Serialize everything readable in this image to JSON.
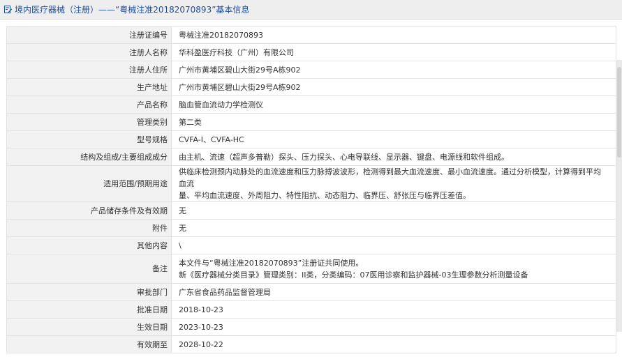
{
  "header": {
    "title": "境内医疗器械（注册）——“粤械注准20182070893”基本信息",
    "icon": "document-edit-icon",
    "color": "#1f4e9a"
  },
  "rows": [
    {
      "label": "注册证编号",
      "value": "粤械注准20182070893"
    },
    {
      "label": "注册人名称",
      "value": "华科盈医疗科技（广州）有限公司"
    },
    {
      "label": "注册人住所",
      "value": "广州市黄埔区碧山大街29号A栋902"
    },
    {
      "label": "生产地址",
      "value": "广州市黄埔区碧山大街29号A栋902"
    },
    {
      "label": "产品名称",
      "value": "脑血管血流动力学检测仪"
    },
    {
      "label": "管理类别",
      "value": "第二类"
    },
    {
      "label": "型号规格",
      "value": "CVFA-I、CVFA-HC"
    },
    {
      "label": "结构及组成/主要组成成分",
      "value": "由主机、流速（超声多普勒）探头、压力探头、心电导联线、显示器、键盘、电源线和软件组成。"
    },
    {
      "label": "适用范围/预期用途",
      "lines": [
        "供临床检测颈内动脉处的血流速度和压力脉搏波波形，检测得到最大血流速度、最小血流速度。通过分析模型，计算得到平均血流",
        "量、平均血流速度、外周阻力、特性阻抗、动态阻力、临界压、舒张压与临界压差值。"
      ]
    },
    {
      "label": "产品储存条件及有效期",
      "value": "无"
    },
    {
      "label": "附件",
      "value": "无"
    },
    {
      "label": "其他内容",
      "value": "\\"
    },
    {
      "label": "备注",
      "lines": [
        "本文件与“粤械注准20182070893”注册证共同使用。",
        "新《医疗器械分类目录》管理类别：II类，分类编码：07医用诊察和监护器械-03生理参数分析测量设备"
      ]
    },
    {
      "label": "审批部门",
      "value": "广东省食品药品监督管理局"
    },
    {
      "label": "批准日期",
      "value": "2018-10-23"
    },
    {
      "label": "生效日期",
      "value": "2023-10-23"
    },
    {
      "label": "有效期至",
      "value": "2028-10-22"
    }
  ]
}
